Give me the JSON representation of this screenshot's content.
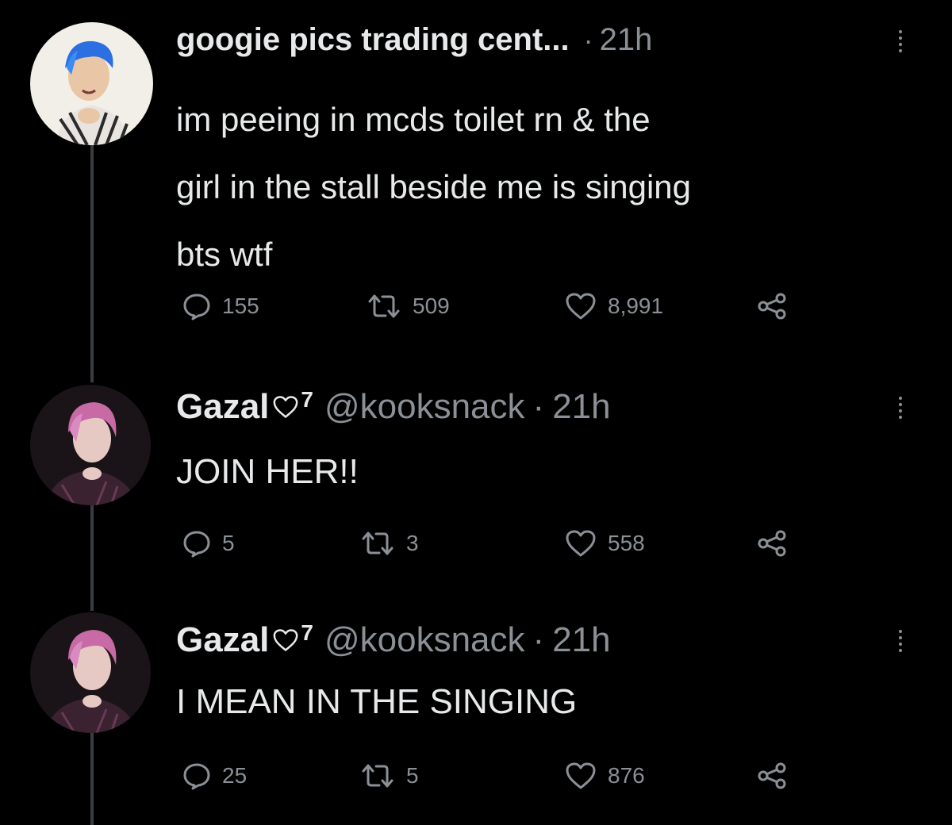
{
  "tweets": [
    {
      "display_name": "googie pics trading cent...",
      "handle": "",
      "separator": "·",
      "time": "21h",
      "text_lines": [
        "im peeing in mcds toilet rn & the",
        "girl in the stall beside me is singing",
        "bts wtf"
      ],
      "replies": "155",
      "retweets": "509",
      "likes": "8,991",
      "avatar_icon": "blue-hair-avatar"
    },
    {
      "display_name": "Gazal",
      "name_suffix": "7",
      "handle": "@kooksnack",
      "separator": "·",
      "time": "21h",
      "text": "JOIN HER!!",
      "replies": "5",
      "retweets": "3",
      "likes": "558",
      "avatar_icon": "pink-hair-avatar"
    },
    {
      "display_name": "Gazal",
      "name_suffix": "7",
      "handle": "@kooksnack",
      "separator": "·",
      "time": "21h",
      "text": "I MEAN IN THE SINGING",
      "replies": "25",
      "retweets": "5",
      "likes": "876",
      "avatar_icon": "pink-hair-avatar"
    }
  ],
  "colors": {
    "background": "#000000",
    "text": "#e7e9ea",
    "muted": "#8b9096",
    "thread_line": "#3a3d40"
  },
  "icons": [
    "reply-icon",
    "retweet-icon",
    "like-icon",
    "share-icon",
    "more-icon",
    "heart-outline-icon"
  ]
}
